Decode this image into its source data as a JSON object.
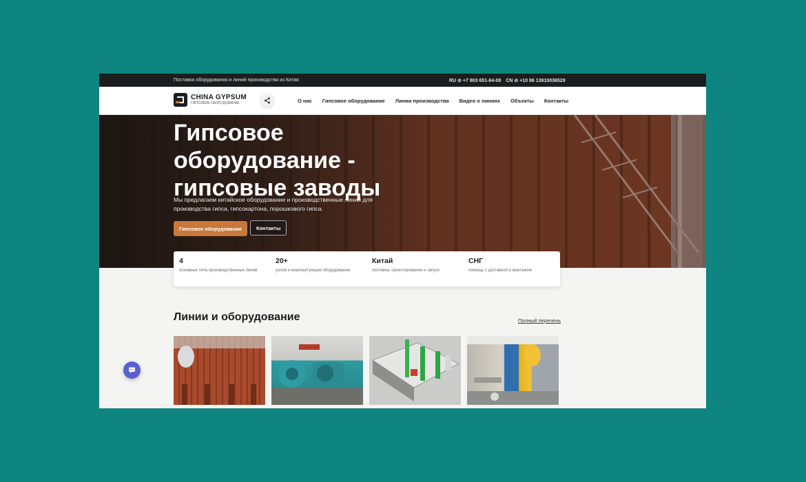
{
  "topbar": {
    "tagline": "Поставка оборудования и линий производства из Китая",
    "phone_ru": "RU ⊘ +7 903 651-64-08",
    "phone_cn": "CN ⊘ +10 86 13910036529"
  },
  "header": {
    "logo_title": "CHINA GYPSUM",
    "logo_subtitle": "ГИПСОВОЕ ОБОРУДОВАНИЕ",
    "nav": [
      "О нас",
      "Гипсовое оборудование",
      "Линии производства",
      "Видео о линиях",
      "Объекты",
      "Контакты"
    ]
  },
  "hero": {
    "title": "Гипсовое оборудование - гипсовые заводы",
    "subtitle": "Мы предлагаем китайское оборудование и производственные линии для производства гипса, гипсокартона, порошкового гипса.",
    "primary_button": "Гипсовое оборудование",
    "secondary_button": "Контакты"
  },
  "stats": [
    {
      "value": "4",
      "label": "основных типа производственных линий"
    },
    {
      "value": "20+",
      "label": "узлов и комплектующих оборудования"
    },
    {
      "value": "Китай",
      "label": "поставка, проектирование и запуск"
    },
    {
      "value": "СНГ",
      "label": "помощь с доставкой и монтажом"
    }
  ],
  "section": {
    "title": "Линии и оборудование",
    "link": "Полный перечень"
  },
  "colors": {
    "background": "#0e8580",
    "accent": "#c8783a",
    "topbar": "#1b1d1e",
    "chat": "#5a5fd0"
  },
  "icons": [
    "share-icon",
    "chat-icon"
  ]
}
